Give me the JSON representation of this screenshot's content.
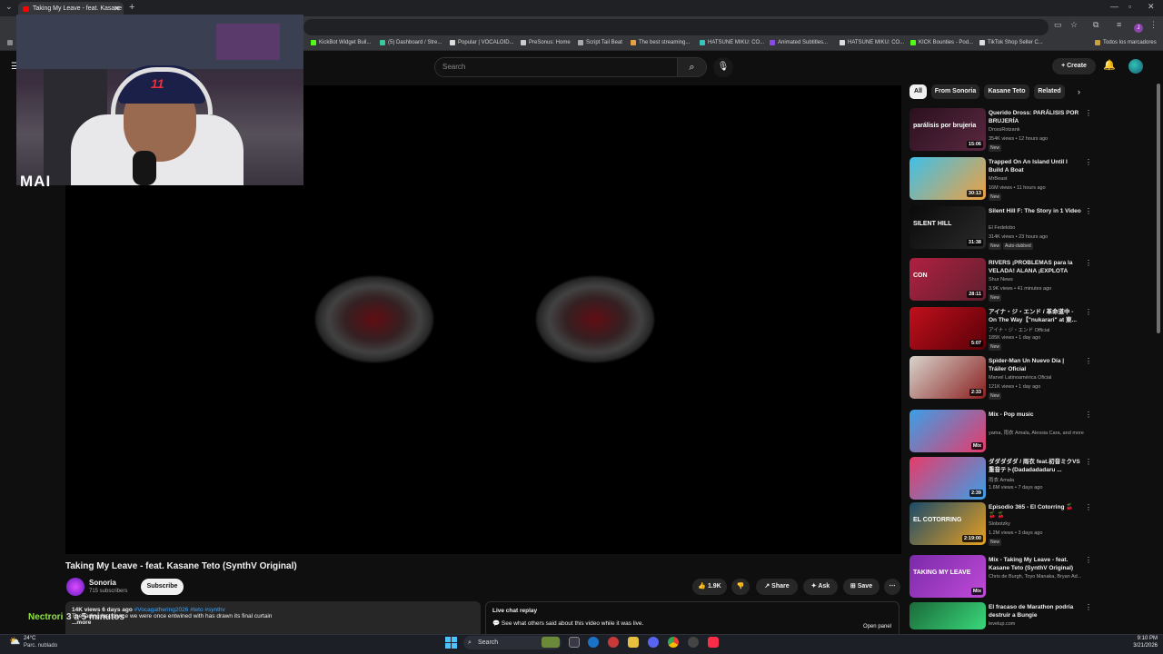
{
  "browser": {
    "tab_title": "Taking My Leave - feat. Kasane",
    "bookmarks": [
      "KickBot Widget Buil...",
      "(5) Dashboard / Stre...",
      "Popular | VOCALOID...",
      "PreSonus: Home",
      "Script Tail Beat",
      "The best streaming...",
      "HATSUNE MIKU: CO...",
      "Animated Subtitles...",
      "HATSUNE MIKU: CO...",
      "KICK Bounties - Pod...",
      "TikTok Shop Seller C...",
      "Todos los marcadores"
    ],
    "profile_initial": "J"
  },
  "header": {
    "search_placeholder": "Search",
    "create_label": "Create"
  },
  "overlay": {
    "webcam_text": "MAI",
    "cap_number": "11",
    "chat_user": "Nectrori",
    "chat_text": "3 a 5 minutos"
  },
  "video": {
    "title": "Taking My Leave - feat. Kasane Teto (SynthV Original)",
    "channel": "Sonoria",
    "subscribers": "715 subscribers",
    "subscribe_label": "Subscribe",
    "likes": "1.9K",
    "share_label": "Share",
    "ask_label": "Ask",
    "save_label": "Save",
    "description": {
      "meta": "14K views  6 days ago",
      "tags": "#Vocagathering2026 #teto #synthv",
      "text": "The fading last dance we were once entwined with has drawn its final curtain",
      "more": "...more"
    },
    "live_chat": {
      "title": "Live chat replay",
      "subtitle": "See what others said about this video while it was live.",
      "open_panel": "Open panel"
    }
  },
  "sidebar": {
    "chips": [
      "All",
      "From Sonoria",
      "Kasane Teto",
      "Related"
    ],
    "recommendations": [
      {
        "title": "Querido Dross: PARÁLISIS POR BRUJERÍA",
        "channel": "DrossRotzank",
        "meta": "354K views • 12 hours ago",
        "duration": "15:06",
        "badge": "New",
        "thumb_text": "parálisis por brujeria",
        "colors": [
          "#2b1020",
          "#5a2840"
        ]
      },
      {
        "title": "Trapped On An Island Until I Build A Boat",
        "channel": "MrBeast",
        "meta": "16M views • 11 hours ago",
        "duration": "30:13",
        "badge": "New",
        "thumb_text": "",
        "colors": [
          "#3ec0e8",
          "#f0a040"
        ]
      },
      {
        "title": "Silent Hill F: The Story in 1 Video",
        "channel": "El Fedelobo",
        "meta": "314K views • 23 hours ago",
        "duration": "31:38",
        "badge": "New",
        "badge2": "Auto-dubbed",
        "thumb_text": "SILENT HILL",
        "colors": [
          "#0a0a0a",
          "#2a2a2a"
        ]
      },
      {
        "title": "RIVERS ¡PROBLEMAS para la VELADA! ALANA ¡EXPLOTA po...",
        "channel": "Shur News",
        "meta": "3.9K views • 41 minutes ago",
        "duration": "28:11",
        "badge": "New",
        "thumb_text": "CON",
        "colors": [
          "#b02040",
          "#602030"
        ]
      },
      {
        "title": "アイナ・ジ・エンド / 革命道中 - On The Way【\"nukarari\" at 東...",
        "channel": "アイナ・ジ・エンド Official",
        "meta": "185K views • 1 day ago",
        "duration": "5:07",
        "badge": "New",
        "thumb_text": "",
        "colors": [
          "#c0101c",
          "#5a0008"
        ]
      },
      {
        "title": "Spider-Man Un Nuevo Día | Tráiler Oficial",
        "channel": "Marvel Latinoamérica Oficial",
        "meta": "121K views • 1 day ago",
        "duration": "2:33",
        "badge": "New",
        "thumb_text": "",
        "colors": [
          "#d8d4cc",
          "#8a2020"
        ]
      },
      {
        "title": "Mix - Pop music",
        "channel": "yama, 雨衣 Amala, Alessia Cara, and more",
        "meta": "",
        "duration": "Mix",
        "badge": "",
        "thumb_text": "",
        "colors": [
          "#3aa0e8",
          "#e83a6a"
        ]
      },
      {
        "title": "ダダダダダ / 雨衣 feat.初音ミクVS重音テト(Dadadadadaru ...",
        "channel": "雨衣 Amala",
        "meta": "1.6M views • 7 days ago",
        "duration": "2:39",
        "badge": "",
        "thumb_text": "",
        "colors": [
          "#e83a6a",
          "#3aa0e8"
        ]
      },
      {
        "title": "Episodio 365 - El Cotorring 🍒 🍒 🍒",
        "channel": "Slobotzky",
        "meta": "1.2M views • 3 days ago",
        "duration": "2:19:00",
        "badge": "New",
        "thumb_text": "EL COTORRING",
        "colors": [
          "#1a4a6a",
          "#e8a020"
        ]
      },
      {
        "title": "Mix - Taking My Leave - feat. Kasane Teto (SynthV Original)",
        "channel": "Chris de Burgh, Toyo Manaka, Bryan Ad...",
        "meta": "",
        "duration": "Mix",
        "badge": "",
        "thumb_text": "TAKING MY LEAVE",
        "colors": [
          "#7a2aa8",
          "#c04ad8"
        ]
      },
      {
        "title": "El fracaso de Marathon podría destruir a Bungie",
        "channel": "levelup.com",
        "meta": "",
        "duration": "",
        "badge": "",
        "thumb_text": "",
        "colors": [
          "#1a6a3a",
          "#3ad87a"
        ]
      }
    ]
  },
  "taskbar": {
    "temp": "24°C",
    "weather": "Parc. nublado",
    "search_label": "Search",
    "time": "9:10 PM",
    "date": "3/21/2026"
  }
}
